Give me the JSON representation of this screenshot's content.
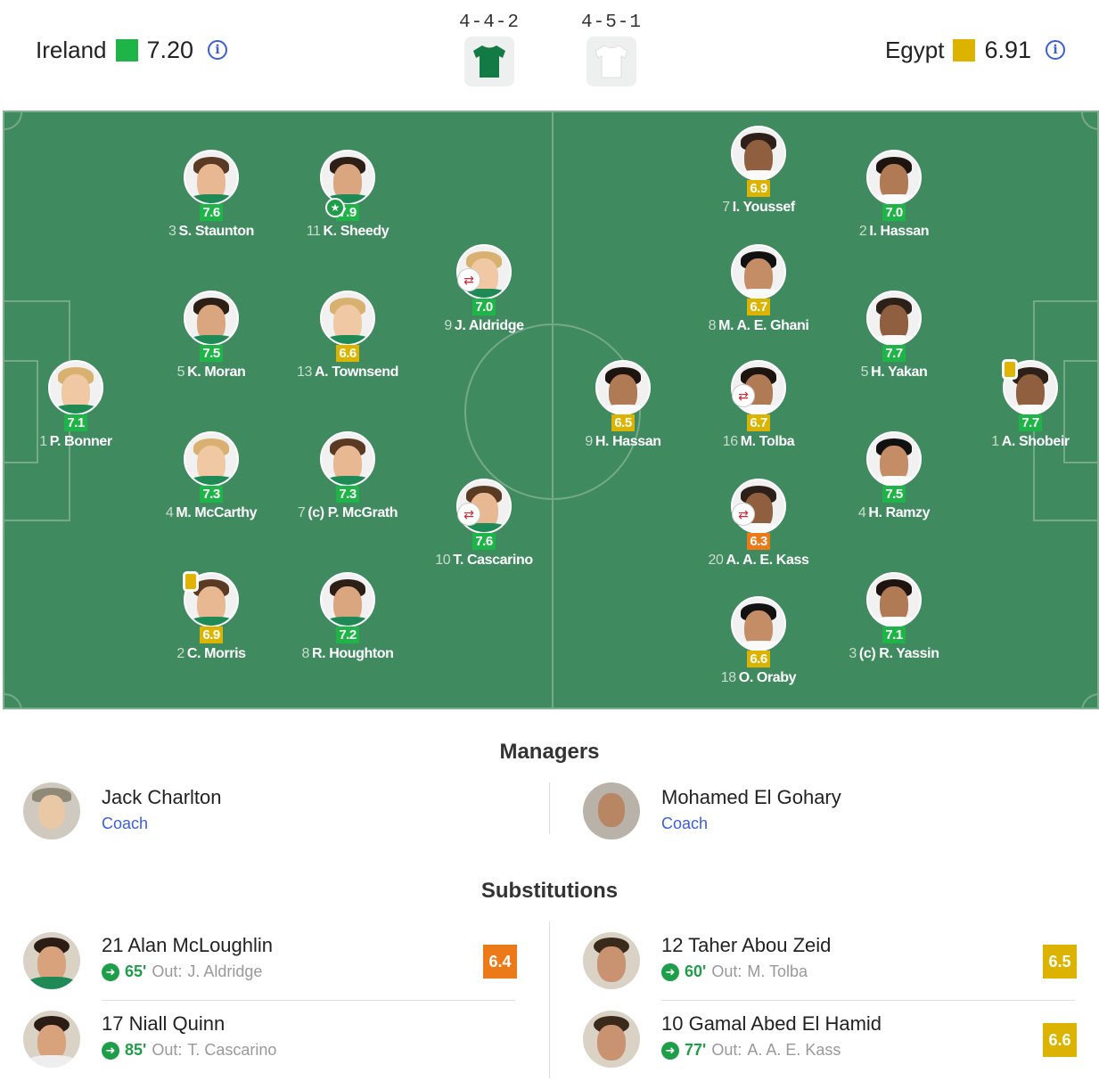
{
  "colors": {
    "green": "#1fb447",
    "yellow": "#dcb400",
    "orange": "#ec7a18",
    "pitch": "#3f8a5f",
    "link": "#3b5fd9"
  },
  "home": {
    "name": "Ireland",
    "rating": "7.20",
    "rating_color": "#1fb447",
    "formation": "4-4-2",
    "shirt_color": "#137a46",
    "players": [
      {
        "id": "bonner",
        "num": "1",
        "name": "P. Bonner",
        "rating": "7.1",
        "color": "#1fb447"
      },
      {
        "id": "staunton",
        "num": "3",
        "name": "S. Staunton",
        "rating": "7.6",
        "color": "#1fb447"
      },
      {
        "id": "moran",
        "num": "5",
        "name": "K. Moran",
        "rating": "7.5",
        "color": "#1fb447"
      },
      {
        "id": "mccarthy",
        "num": "4",
        "name": "M. McCarthy",
        "rating": "7.3",
        "color": "#1fb447"
      },
      {
        "id": "morris",
        "num": "2",
        "name": "C. Morris",
        "rating": "6.9",
        "color": "#dcb400"
      },
      {
        "id": "sheedy",
        "num": "11",
        "name": "K. Sheedy",
        "rating": "7.9",
        "color": "#1fb447"
      },
      {
        "id": "townsend",
        "num": "13",
        "name": "A. Townsend",
        "rating": "6.6",
        "color": "#dcb400"
      },
      {
        "id": "mcgrath",
        "num": "7",
        "name": "(c) P. McGrath",
        "rating": "7.3",
        "color": "#1fb447"
      },
      {
        "id": "houghton",
        "num": "8",
        "name": "R. Houghton",
        "rating": "7.2",
        "color": "#1fb447"
      },
      {
        "id": "aldridge",
        "num": "9",
        "name": "J. Aldridge",
        "rating": "7.0",
        "color": "#1fb447"
      },
      {
        "id": "cascarino",
        "num": "10",
        "name": "T. Cascarino",
        "rating": "7.6",
        "color": "#1fb447"
      }
    ]
  },
  "away": {
    "name": "Egypt",
    "rating": "6.91",
    "rating_color": "#dcb400",
    "formation": "4-5-1",
    "shirt_color": "#ffffff",
    "players": [
      {
        "id": "hhassan",
        "num": "9",
        "name": "H. Hassan",
        "rating": "6.5",
        "color": "#dcb400"
      },
      {
        "id": "youssef",
        "num": "7",
        "name": "I. Youssef",
        "rating": "6.9",
        "color": "#dcb400"
      },
      {
        "id": "ghani",
        "num": "8",
        "name": "M. A. E. Ghani",
        "rating": "6.7",
        "color": "#dcb400"
      },
      {
        "id": "tolba",
        "num": "16",
        "name": "M. Tolba",
        "rating": "6.7",
        "color": "#dcb400"
      },
      {
        "id": "kass",
        "num": "20",
        "name": "A. A. E. Kass",
        "rating": "6.3",
        "color": "#ec7a18"
      },
      {
        "id": "oraby",
        "num": "18",
        "name": "O. Oraby",
        "rating": "6.6",
        "color": "#dcb400"
      },
      {
        "id": "ihassan",
        "num": "2",
        "name": "I. Hassan",
        "rating": "7.0",
        "color": "#1fb447"
      },
      {
        "id": "yakan",
        "num": "5",
        "name": "H. Yakan",
        "rating": "7.7",
        "color": "#1fb447"
      },
      {
        "id": "ramzy",
        "num": "4",
        "name": "H. Ramzy",
        "rating": "7.5",
        "color": "#1fb447"
      },
      {
        "id": "yassin",
        "num": "3",
        "name": "(c) R. Yassin",
        "rating": "7.1",
        "color": "#1fb447"
      },
      {
        "id": "shobeir",
        "num": "1",
        "name": "A. Shobeir",
        "rating": "7.7",
        "color": "#1fb447"
      }
    ]
  },
  "managers": {
    "title": "Managers",
    "home": {
      "name": "Jack Charlton",
      "role": "Coach"
    },
    "away": {
      "name": "Mohamed El Gohary",
      "role": "Coach"
    }
  },
  "substitutions": {
    "title": "Substitutions",
    "home": [
      {
        "label": "21 Alan McLoughlin",
        "minute": "65'",
        "out_label": "Out:",
        "out": "J. Aldridge",
        "rating": "6.4",
        "color": "#ec7a18"
      },
      {
        "label": "17 Niall Quinn",
        "minute": "85'",
        "out_label": "Out:",
        "out": "T. Cascarino",
        "rating": "",
        "color": ""
      }
    ],
    "away": [
      {
        "label": "12 Taher Abou Zeid",
        "minute": "60'",
        "out_label": "Out:",
        "out": "M. Tolba",
        "rating": "6.5",
        "color": "#dcb400"
      },
      {
        "label": "10 Gamal Abed El Hamid",
        "minute": "77'",
        "out_label": "Out:",
        "out": "A. A. E. Kass",
        "rating": "6.6",
        "color": "#dcb400"
      }
    ]
  },
  "icons": {
    "info": "info-icon",
    "substitution": "swap-icon",
    "motm": "star-icon",
    "sub_in": "arrow-right-icon",
    "card": "yellow-card-icon"
  }
}
